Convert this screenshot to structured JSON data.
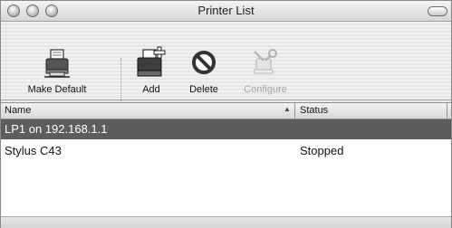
{
  "window": {
    "title": "Printer List",
    "controls": [
      "close-button",
      "minimize-button",
      "zoom-button"
    ]
  },
  "toolbar": {
    "make_default_label": "Make Default",
    "add_label": "Add",
    "delete_label": "Delete",
    "configure_label": "Configure",
    "configure_enabled": false
  },
  "table": {
    "columns": {
      "name": "Name",
      "status": "Status",
      "sorted_by": "Name",
      "sort_direction": "ascending"
    },
    "rows": [
      {
        "name": "LP1 on 192.168.1.1",
        "status": "",
        "selected": true
      },
      {
        "name": "Stylus C43",
        "status": "Stopped",
        "selected": false
      }
    ]
  },
  "colors": {
    "selection": "#5d5d5d",
    "disabled_text": "#a6a6a6"
  }
}
